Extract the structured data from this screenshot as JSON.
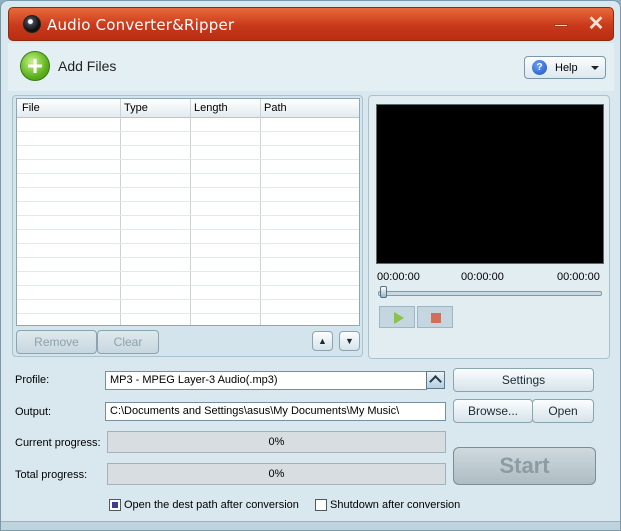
{
  "window": {
    "title": "Audio Converter&Ripper"
  },
  "toolbar": {
    "add_files_label": "Add Files",
    "help_label": "Help"
  },
  "file_table": {
    "columns": [
      "File",
      "Type",
      "Length",
      "Path"
    ],
    "rows": []
  },
  "list_buttons": {
    "remove_label": "Remove",
    "clear_label": "Clear"
  },
  "player": {
    "time_start": "00:00:00",
    "time_mid": "00:00:00",
    "time_end": "00:00:00",
    "position": 0
  },
  "form": {
    "profile_label": "Profile:",
    "profile_value": "MP3 - MPEG Layer-3 Audio(.mp3)",
    "output_label": "Output:",
    "output_value": "C:\\Documents and Settings\\asus\\My Documents\\My Music\\",
    "current_progress_label": "Current progress:",
    "current_progress_value": "0%",
    "total_progress_label": "Total progress:",
    "total_progress_value": "0%"
  },
  "buttons": {
    "settings_label": "Settings",
    "browse_label": "Browse...",
    "open_label": "Open",
    "start_label": "Start"
  },
  "options": {
    "open_dest_label": "Open the dest path after conversion",
    "open_dest_checked": true,
    "shutdown_label": "Shutdown after conversion",
    "shutdown_checked": false
  }
}
